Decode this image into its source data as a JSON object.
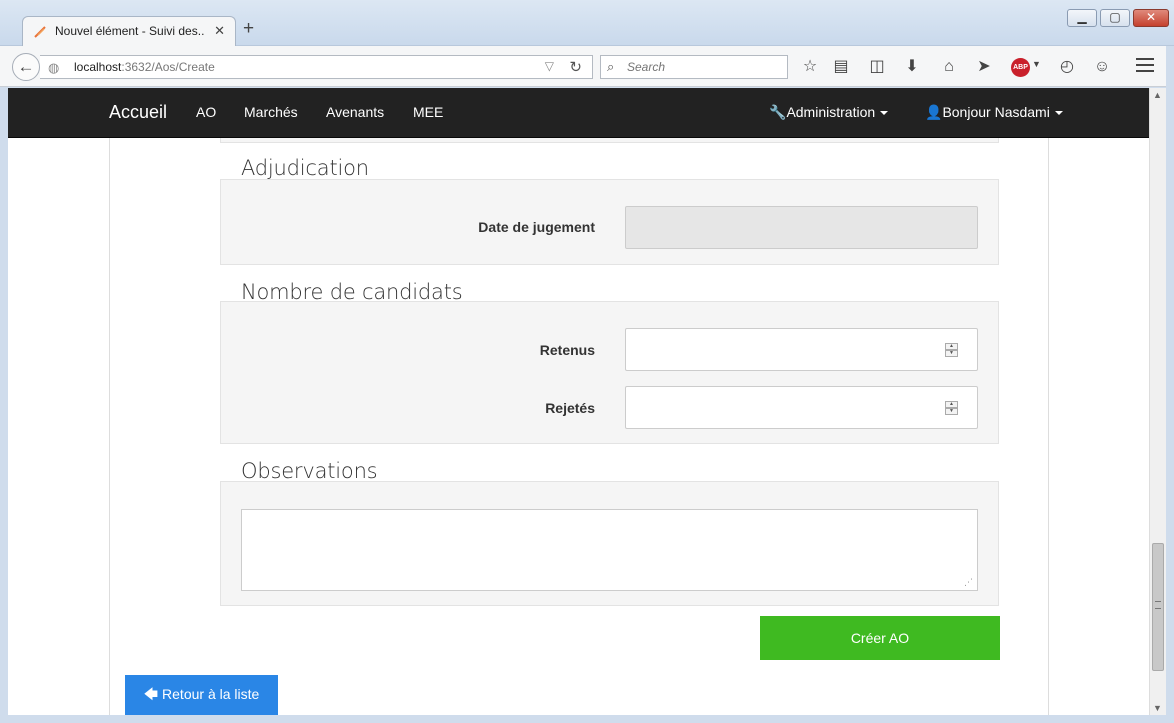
{
  "browser": {
    "tab_title": "Nouvel élément - Suivi des...",
    "url_host": "localhost",
    "url_path": ":3632/Aos/Create",
    "search_placeholder": "Search"
  },
  "app": {
    "brand": "Accueil",
    "nav": {
      "ao": "AO",
      "marches": "Marchés",
      "avenants": "Avenants",
      "mee": "MEE",
      "admin": "Administration",
      "user": "Bonjour Nasdami"
    }
  },
  "form": {
    "adjudication": {
      "legend": "Adjudication",
      "date_label": "Date de jugement",
      "date_value": ""
    },
    "candidats": {
      "legend": "Nombre de candidats",
      "retenus_label": "Retenus",
      "retenus_value": "",
      "rejetes_label": "Rejetés",
      "rejetes_value": ""
    },
    "observations": {
      "legend": "Observations",
      "value": ""
    },
    "submit_label": "Créer AO",
    "back_label": "Retour à la liste"
  },
  "colors": {
    "navbar_bg": "#222222",
    "submit_green": "#3fba21",
    "back_blue": "#2a86e6",
    "well_bg": "#f5f5f5"
  }
}
